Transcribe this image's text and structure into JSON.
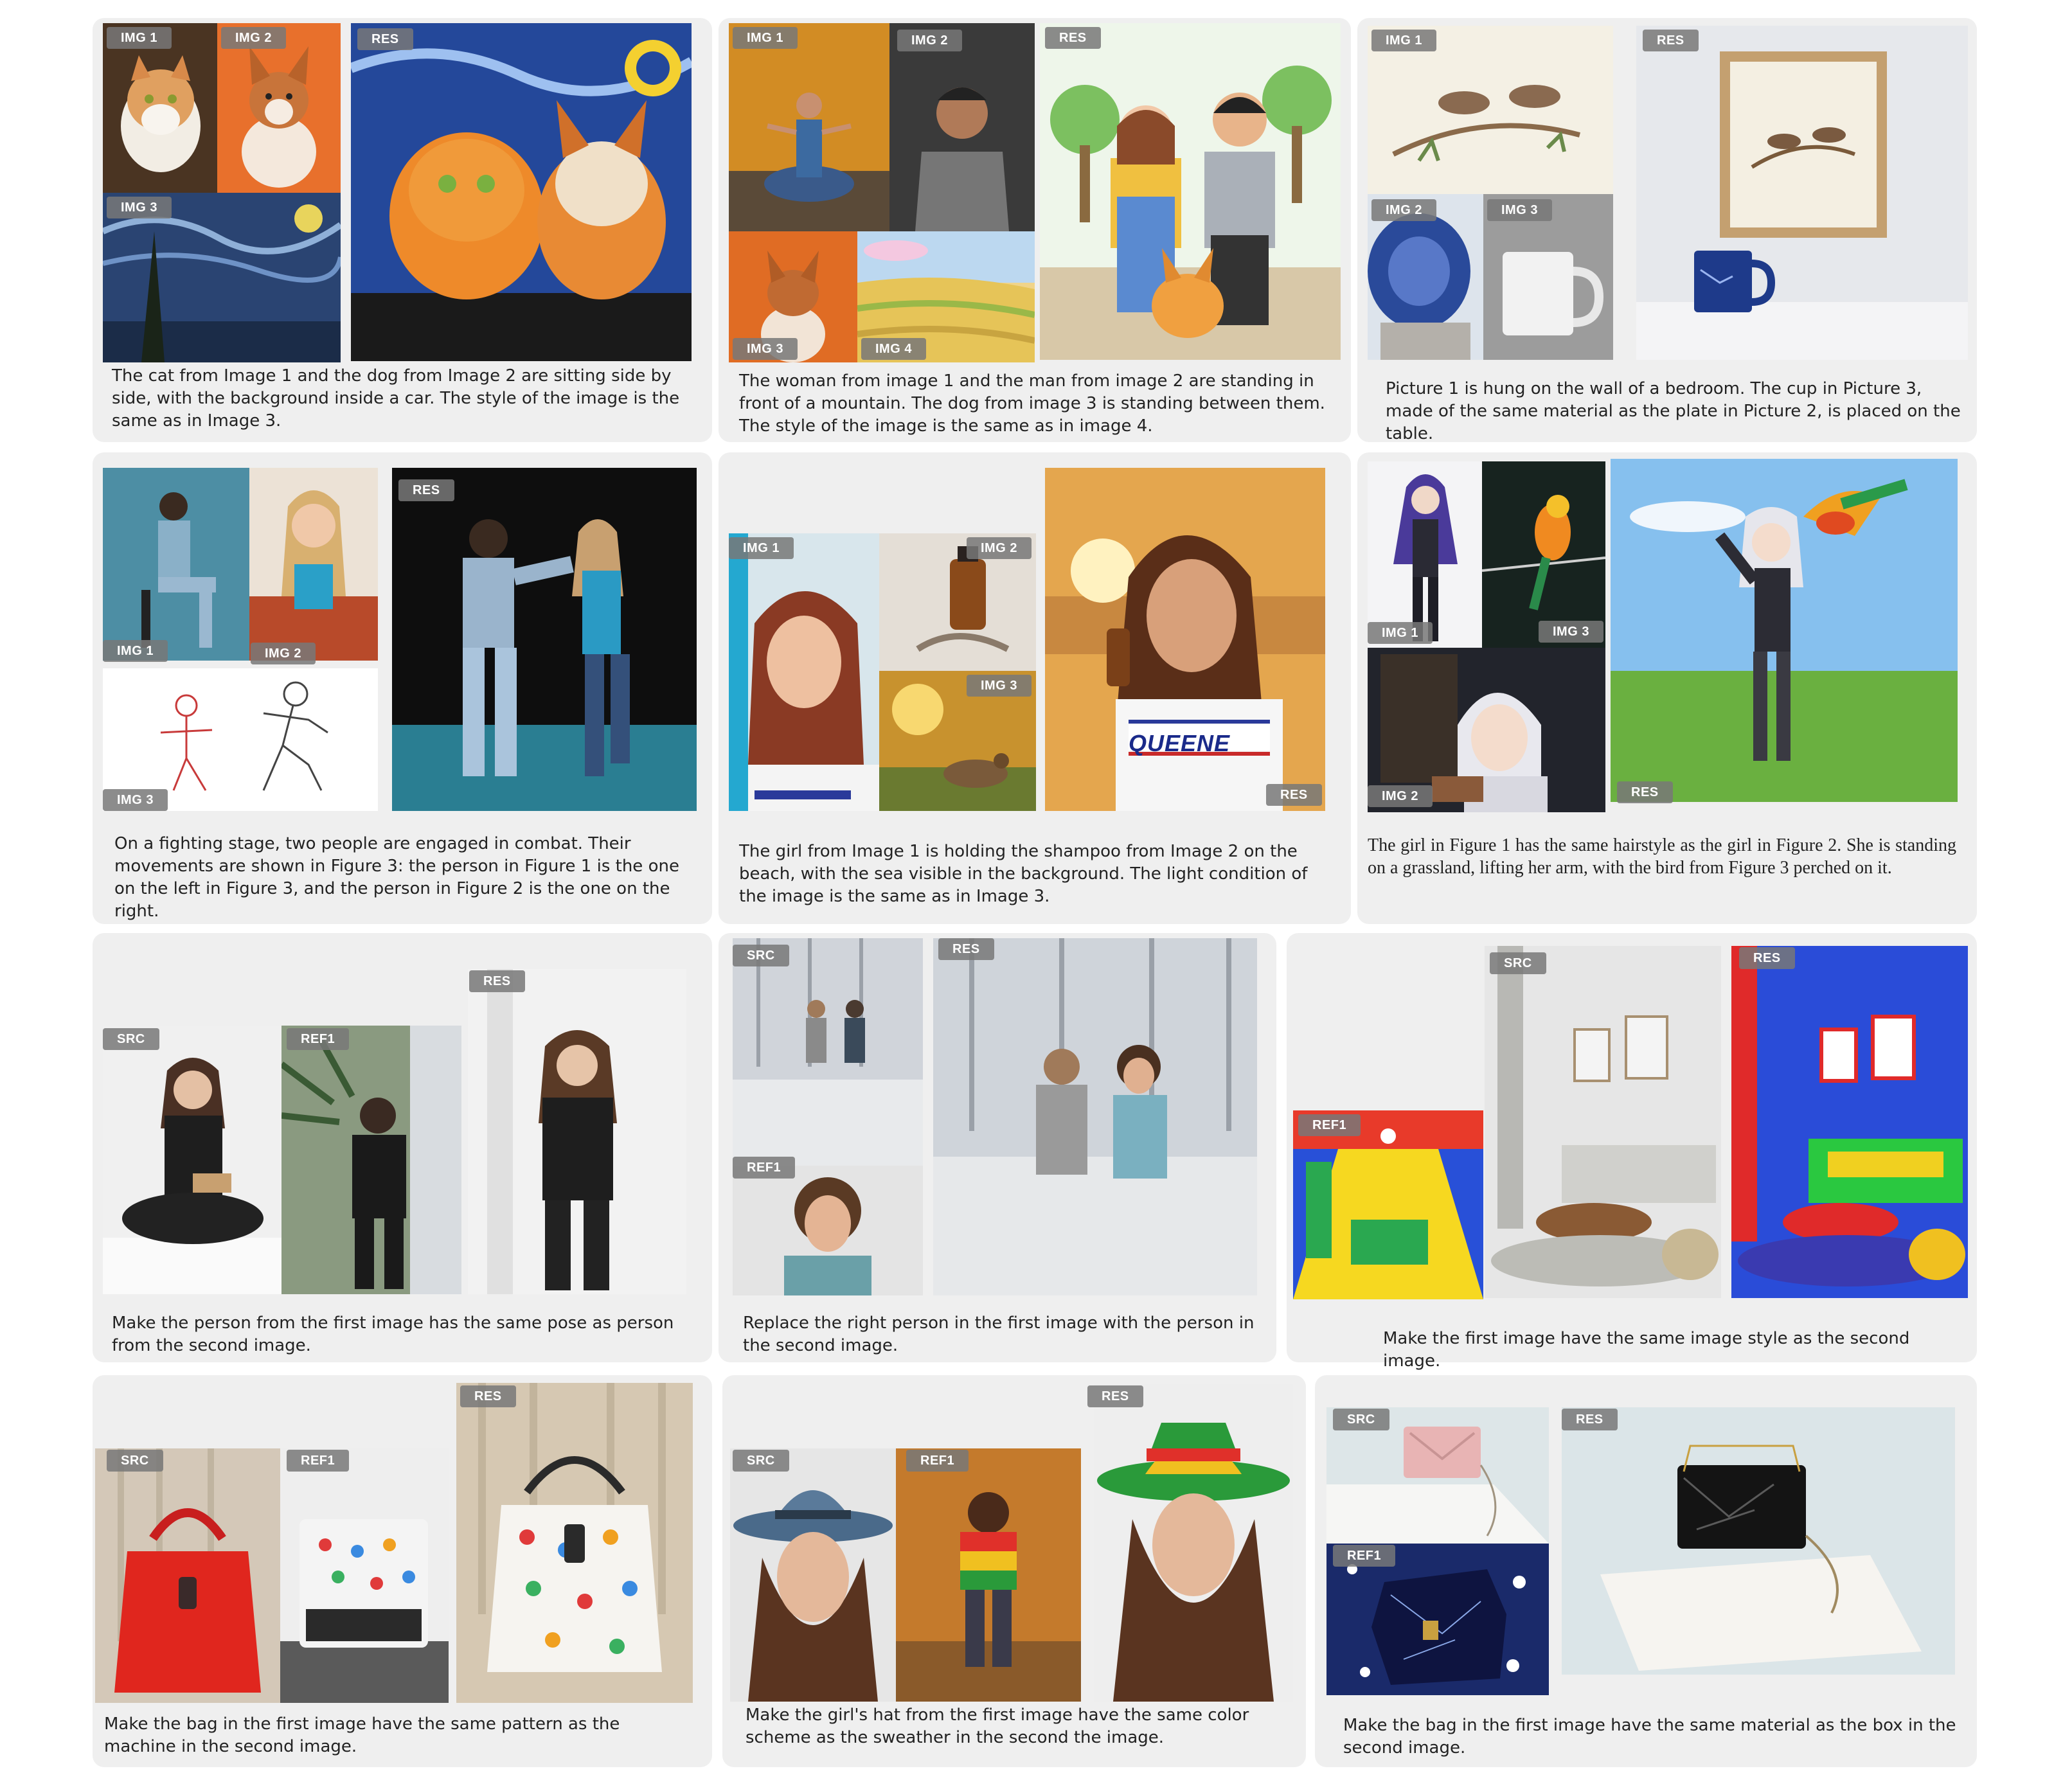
{
  "tags": {
    "img1": "IMG 1",
    "img2": "IMG 2",
    "img3": "IMG 3",
    "img4": "IMG 4",
    "res": "RES",
    "src": "SRC",
    "ref1": "REF1"
  },
  "captions": {
    "p1": "The cat from Image 1 and the dog from Image 2 are sitting side by side, with the background inside a car. The style of the image is the same as in Image 3.",
    "p2": "The woman from image 1 and the man from image 2 are standing in front of a mountain. The dog from image 3 is standing between them. The style of the image is the same as in image 4.",
    "p3": "Picture 1 is hung on the wall of a bedroom. The cup in Picture 3, made of the same material as the plate in Picture 2, is placed on the table.",
    "p4": "On a fighting stage, two people are engaged in combat. Their movements are shown in Figure 3: the person in Figure 1 is the one on the left in Figure 3, and the person in Figure 2 is the one on the right.",
    "p5": "The girl from Image 1 is holding the shampoo from Image 2 on the beach, with the sea visible in the background. The light condition of the image is the same as in Image 3.",
    "p6": "The girl in Figure 1 has the same hairstyle as the girl in Figure 2. She is standing on a grassland, lifting her arm, with the bird from Figure 3 perched on it.",
    "p7": "Make the person from the first image has the same pose as person from the second image.",
    "p8": "Replace the right person in the first image with the person in the second image.",
    "p9": "Make the first image have the same image style as the second image.",
    "p10": "Make the bag in the first image have the same pattern as the machine in the second image.",
    "p11": "Make the girl's hat from the first image have the same color scheme as the sweather in the second the image.",
    "p12": "Make the bag in the first image have the same material as the box in the second image."
  },
  "overlay_text": {
    "shirt_print": "QUEENE"
  },
  "colors": {
    "panel_bg": "#efefef",
    "tag_bg": "#787878"
  }
}
